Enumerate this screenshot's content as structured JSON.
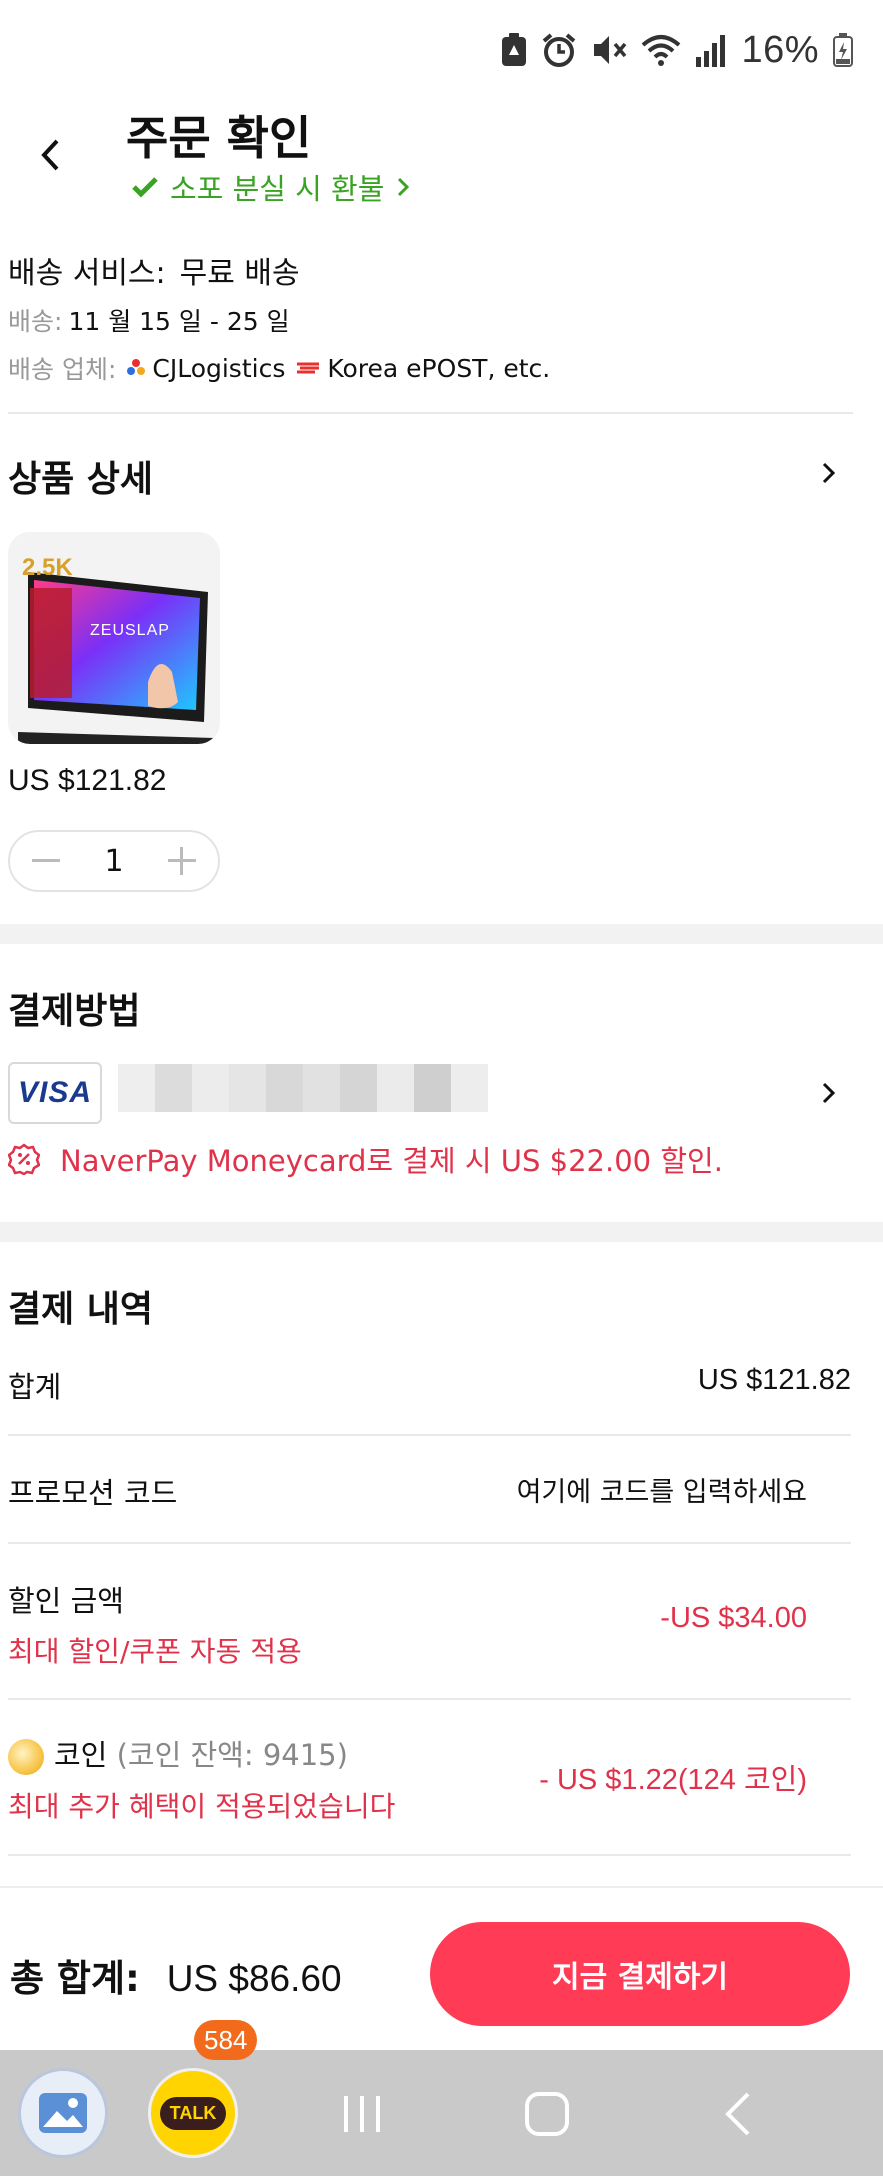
{
  "status_bar": {
    "battery_percent": "16%",
    "icons": [
      "notification-icon",
      "alarm-icon",
      "mute-icon",
      "wifi-icon",
      "signal-icon",
      "battery-icon"
    ]
  },
  "header": {
    "title": "주문 확인",
    "refund_text": "소포 분실 시 환불"
  },
  "shipping": {
    "service_label": "배송 서비스:",
    "service_value": "무료 배송",
    "date_label": "배송:",
    "date_value": "11 월 15 일 - 25 일",
    "carrier_label": "배송 업체:",
    "carrier_1": "CJLogistics",
    "carrier_2": "Korea ePOST, etc."
  },
  "product": {
    "section_title": "상품 상세",
    "price": "US $121.82",
    "quantity": "1",
    "image_texts": [
      "2.5K",
      "ZEUSLAP"
    ]
  },
  "payment": {
    "section_title": "결제방법",
    "card_brand": "VISA",
    "promo_text": "NaverPay Moneycard로 결제 시 US $22.00 할인."
  },
  "summary": {
    "section_title": "결제 내역",
    "subtotal_label": "합계",
    "subtotal_value": "US $121.82",
    "promo_label": "프로모션 코드",
    "promo_placeholder": "여기에 코드를 입력하세요",
    "discount_label": "할인 금액",
    "discount_sub": "최대 할인/쿠폰 자동 적용",
    "discount_value": "-US $34.00",
    "coin_label": "코인",
    "coin_balance": "(코인 잔액: 9415)",
    "coin_sub": "최대 추가 혜택이 적용되었습니다",
    "coin_value": "- US $1.22(124 코인)"
  },
  "footer": {
    "total_label": "총 합계:",
    "total_value": "US $86.60",
    "pay_button": "지금 결제하기"
  },
  "nav": {
    "talk_badge": "584",
    "talk_label": "TALK"
  },
  "colors": {
    "accent_red": "#e0324a",
    "pay_button": "#ff3b55",
    "green": "#3aa324"
  }
}
